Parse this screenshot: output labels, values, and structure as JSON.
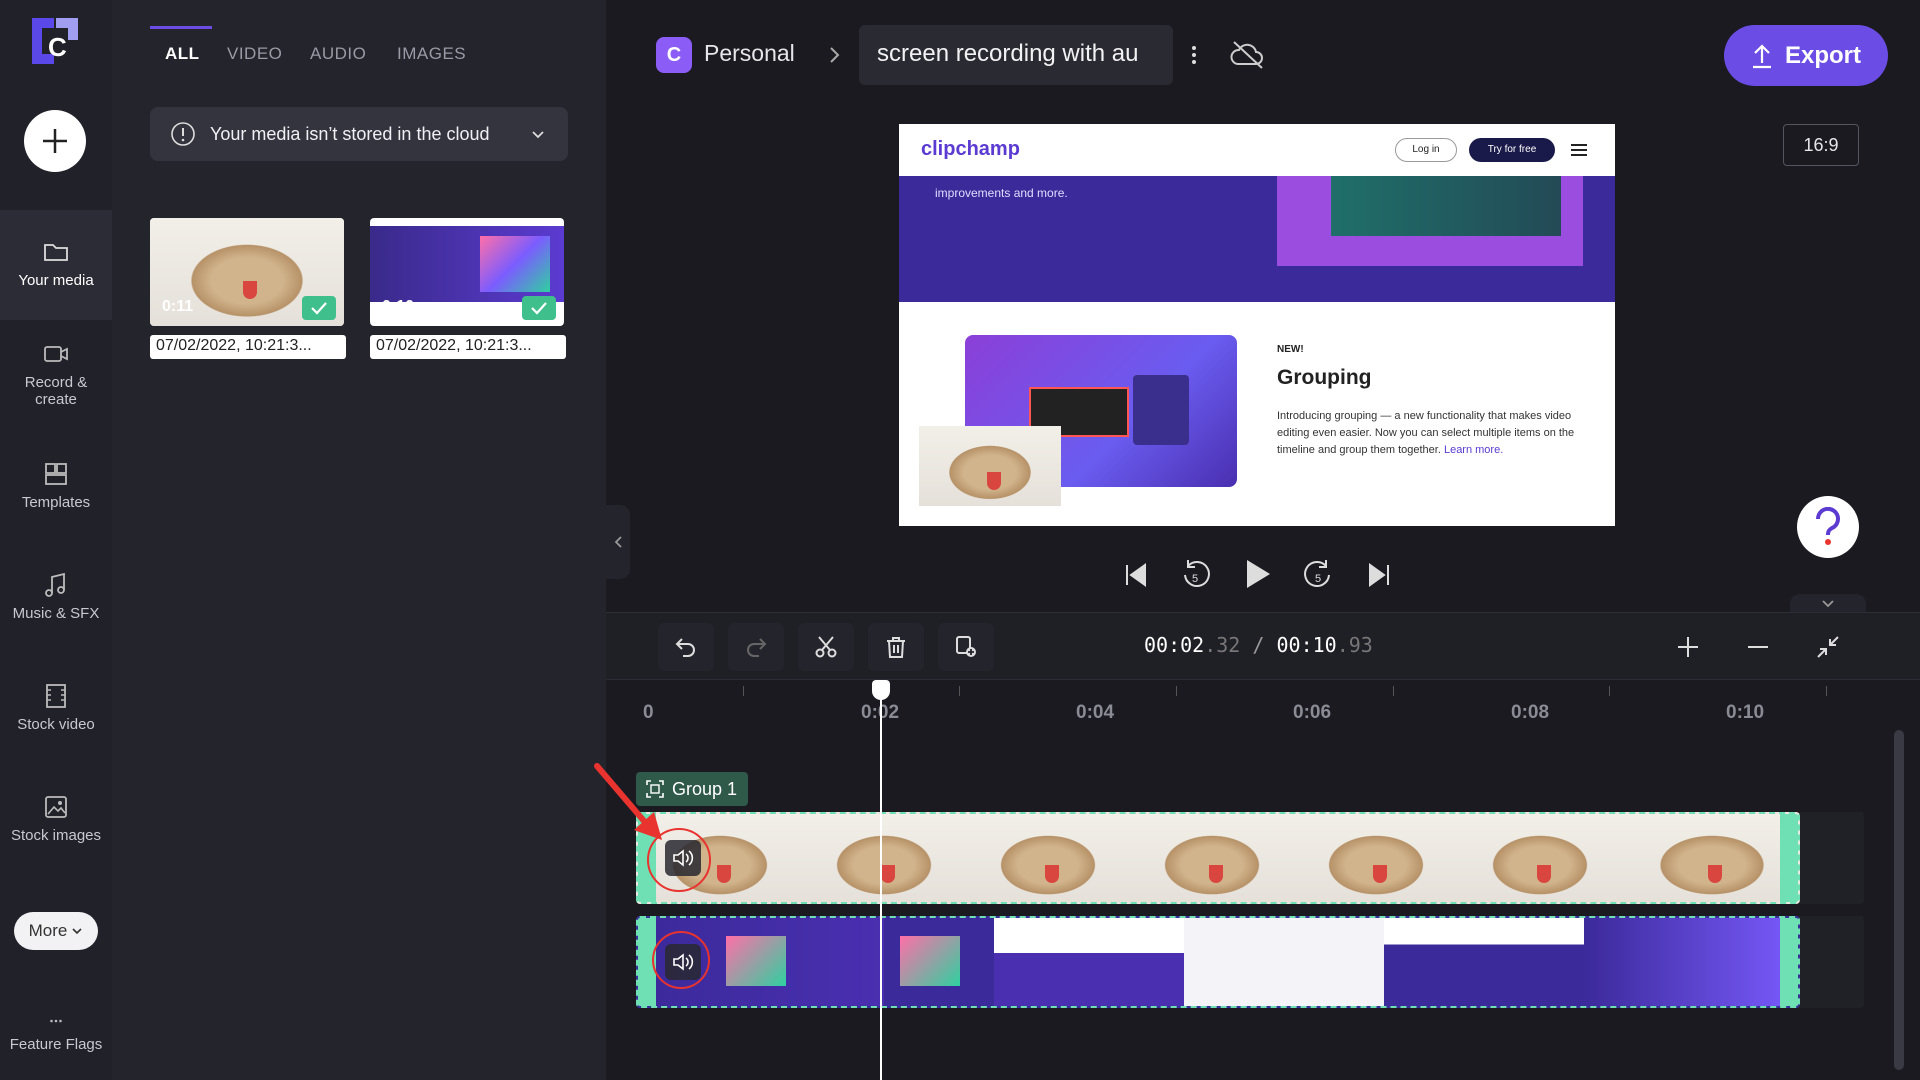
{
  "rail": {
    "more_label": "More",
    "items": [
      {
        "label": "Your media",
        "icon": "folder-icon"
      },
      {
        "label": "Record & create",
        "icon": "camera-icon"
      },
      {
        "label": "Templates",
        "icon": "templates-icon"
      },
      {
        "label": "Music & SFX",
        "icon": "music-icon"
      },
      {
        "label": "Stock video",
        "icon": "film-icon"
      },
      {
        "label": "Stock images",
        "icon": "image-icon"
      },
      {
        "label": "Feature Flags",
        "icon": "dots-icon"
      }
    ]
  },
  "panel": {
    "tabs": [
      "ALL",
      "VIDEO",
      "AUDIO",
      "IMAGES"
    ],
    "cloud_notice": "Your media isn’t stored in the cloud",
    "media": [
      {
        "duration": "0:11",
        "name": "07/02/2022, 10:21:3..."
      },
      {
        "duration": "0:10",
        "name": "07/02/2022, 10:21:3..."
      }
    ]
  },
  "header": {
    "workspace_initial": "C",
    "workspace": "Personal",
    "project_title": "screen recording with au",
    "export_label": "Export",
    "aspect_ratio": "16:9"
  },
  "preview": {
    "brand": "clipchamp",
    "login": "Log in",
    "try_free": "Try for free",
    "banner_text": "improvements and more.",
    "new_badge": "NEW!",
    "heading": "Grouping",
    "body": "Introducing grouping — a new functionality that makes video editing even easier. Now you can select multiple items on the timeline and group them together.",
    "learn_more": "Learn more."
  },
  "timeline": {
    "time_current": "00:02",
    "time_current_ms": ".32",
    "separator": "/",
    "time_total": "00:10",
    "time_total_ms": ".93",
    "ruler": [
      "0",
      "0:02",
      "0:04",
      "0:06",
      "0:08",
      "0:10"
    ],
    "group_label": "Group 1"
  },
  "colors": {
    "accent": "#6b4de6",
    "clip_border": "#6ee0b4",
    "annotation": "#e8332f"
  }
}
